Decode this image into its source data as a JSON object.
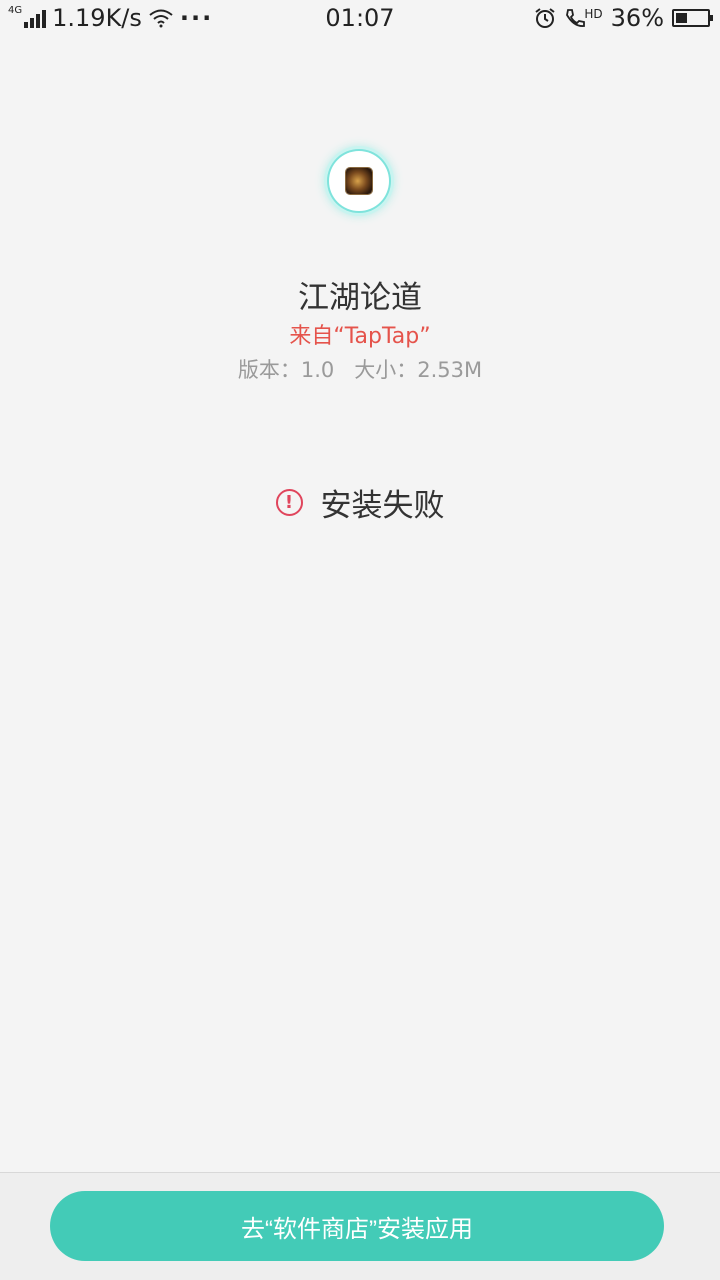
{
  "status_bar": {
    "network_type": "4G",
    "speed": "1.19K/s",
    "more": "···",
    "time": "01:07",
    "hd_label": "HD",
    "battery": "36%",
    "battery_level": 0.36
  },
  "app": {
    "name": "江湖论道",
    "source": "来自“TapTap”",
    "version": "版本：1.0",
    "size": "大小：2.53M"
  },
  "status": {
    "fail_text": "安装失败"
  },
  "bottom": {
    "store_button_label": "去“软件商店”安装应用"
  },
  "colors": {
    "accent": "#43cbb7",
    "error": "#e0455c",
    "source": "#e5534b"
  }
}
